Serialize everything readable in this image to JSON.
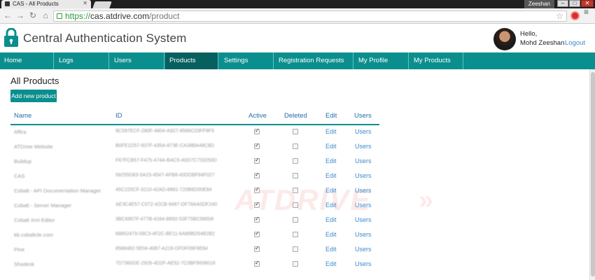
{
  "browser": {
    "tab_title": "CAS - All Products",
    "user_badge": "Zeeshan",
    "url_scheme": "https://",
    "url_host": "cas.atdrive.com",
    "url_path": "/product"
  },
  "header": {
    "app_title": "Central Authentication System",
    "greeting": "Hello,",
    "username": "Mohd Zeeshan",
    "logout_label": "Logout"
  },
  "nav": {
    "items": [
      {
        "label": "Home"
      },
      {
        "label": "Logs"
      },
      {
        "label": "Users"
      },
      {
        "label": "Products"
      },
      {
        "label": "Settings"
      },
      {
        "label": "Registration Requests (0)"
      },
      {
        "label": "My Profile"
      },
      {
        "label": "My Products"
      }
    ],
    "active": "Products"
  },
  "main": {
    "title": "All Products",
    "add_button": "Add new product",
    "columns": [
      "Name",
      "ID",
      "Active",
      "Deleted",
      "Edit",
      "Users"
    ],
    "rows": [
      {
        "name": "Affira",
        "id": "9C597ECF-280F-4804-A927-8586C03FF9F5",
        "active": true,
        "deleted": false,
        "edit": "Edit",
        "users": "Users"
      },
      {
        "name": "ATDrive Website",
        "id": "B0FE1D57-837F-435A-873E-CA38BA48C8D",
        "active": true,
        "deleted": false,
        "edit": "Edit",
        "users": "Users"
      },
      {
        "name": "Buildup",
        "id": "F67FCB57-F475-474A-BAC5-A0D7C733250D",
        "active": true,
        "deleted": false,
        "edit": "Edit",
        "users": "Users"
      },
      {
        "name": "CAS",
        "id": "58255D83-5A23-4547-AFB8-40DDBF84F027",
        "active": true,
        "deleted": false,
        "edit": "Edit",
        "users": "Users"
      },
      {
        "name": "Cobalt - API Documentation Manager",
        "id": "45C225CF-3210-42AD-8881-720B8D00E84",
        "active": true,
        "deleted": false,
        "edit": "Edit",
        "users": "Users"
      },
      {
        "name": "Cobalt - Server Manager",
        "id": "AE3C4E57-C072-42CB-9487-DF78AA0DF240",
        "active": true,
        "deleted": false,
        "edit": "Edit",
        "users": "Users"
      },
      {
        "name": "Cobalt Xml Editor",
        "id": "3BC6957F-477B-4184-B892-53F75BC99008",
        "active": true,
        "deleted": false,
        "edit": "Edit",
        "users": "Users"
      },
      {
        "name": "kb.cobaltcle.com",
        "id": "68852479-09C3-4F2C-BE11-6A89BD54B2B2",
        "active": true,
        "deleted": false,
        "edit": "Edit",
        "users": "Users"
      },
      {
        "name": "Pine",
        "id": "8588482-5E04-4087-A216-DFDF09F6E84",
        "active": true,
        "deleted": false,
        "edit": "Edit",
        "users": "Users"
      },
      {
        "name": "Shodesk",
        "id": "7D7360DE-2926-4D2F-AE52-7C0BF9008018",
        "active": true,
        "deleted": false,
        "edit": "Edit",
        "users": "Users"
      }
    ]
  },
  "watermark": "ATDRIVE",
  "colors": {
    "brand_teal": "#0b8f8e",
    "nav_active": "#06605f",
    "link_blue": "#3d8bcd"
  }
}
